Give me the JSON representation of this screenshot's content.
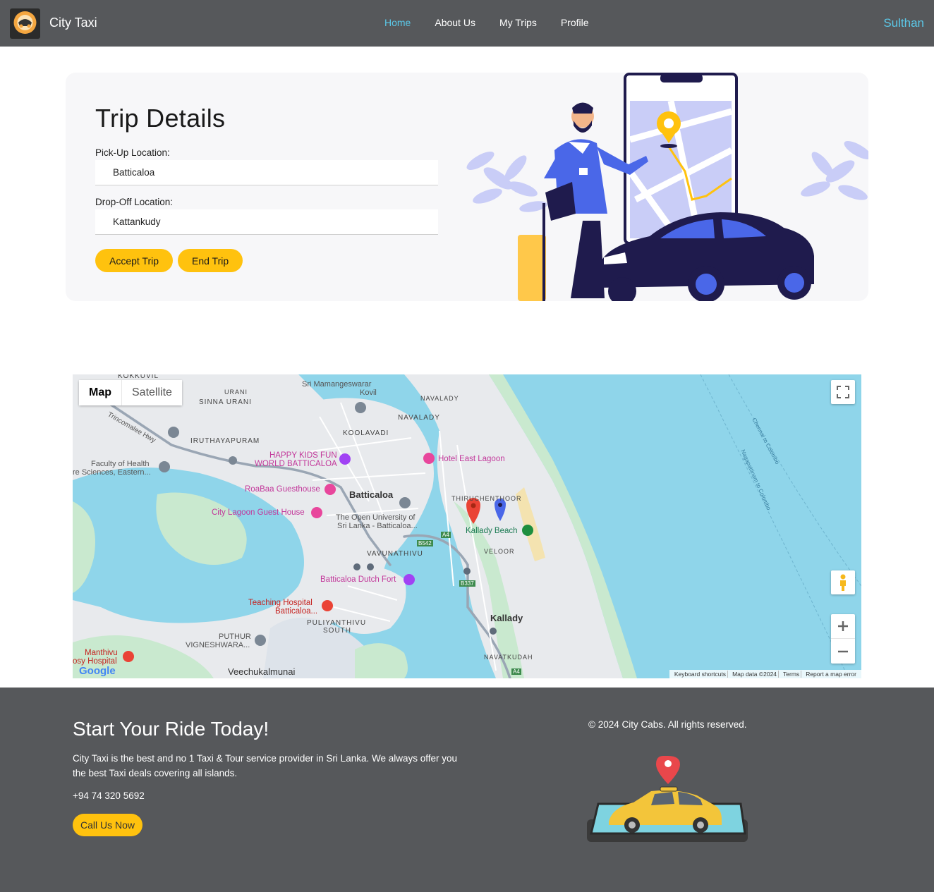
{
  "navbar": {
    "brand": "City Taxi",
    "links": [
      "Home",
      "About Us",
      "My Trips",
      "Profile"
    ],
    "user": "Sulthan"
  },
  "trip": {
    "title": "Trip Details",
    "pickup_label": "Pick-Up Location:",
    "pickup_value": "Batticaloa",
    "dropoff_label": "Drop-Off Location:",
    "dropoff_value": "Kattankudy",
    "accept_label": "Accept Trip",
    "end_label": "End Trip"
  },
  "map": {
    "type_map": "Map",
    "type_satellite": "Satellite",
    "labels": {
      "kokkuvil": "KOKKUVIL",
      "urani": "URANI",
      "sinna_urani": "SINNA URANI",
      "mamangeswarar": "Sri Mamangeswarar",
      "kovil": "Kovil",
      "navalady_top": "NAVALADY",
      "navalady": "NAVALADY",
      "trincomalee_hwy": "Trincomalee Hwy",
      "koolavadi": "KOOLAVADI",
      "iruthayapuram": "IRUTHAYAPURAM",
      "happy_kids": "HAPPY KIDS FUN",
      "world_batticaloa": "WORLD BATTICALOA",
      "hotel_east_lagoon": "Hotel East Lagoon",
      "faculty1": "Faculty of Health",
      "faculty2": "re Sciences, Eastern...",
      "roabaa": "RoaBaa Guesthouse",
      "batticaloa": "Batticaloa",
      "thiruchenthoor": "THIRUCHENTHOOR",
      "city_lagoon": "City Lagoon Guest House",
      "open_university1": "The Open University of",
      "open_university2": "Sri Lanka - Batticaloa...",
      "kallady_beach": "Kallady Beach",
      "b542": "B542",
      "a4_top": "A4",
      "vavunathivu": "VAVUNATHIVU",
      "veloor": "VELOOR",
      "dutch_fort": "Batticaloa Dutch Fort",
      "b337": "B337",
      "teaching_hospital1": "Teaching Hospital",
      "teaching_hospital2": "Batticaloa...",
      "kallady": "Kallady",
      "puliyanthivu1": "PULIYANTHIVU",
      "puliyanthivu2": "SOUTH",
      "puthur1": "PUTHUR",
      "puthur2": "VIGNESHWARA...",
      "manthivu1": "Manthivu",
      "manthivu2": "osy Hospital",
      "navatkudah": "NAVATKUDAH",
      "veechukalmunai": "Veechukalmunai",
      "a4_bottom": "A4",
      "chennai_colombo": "Chennai to Colombo",
      "nagapattinam_colombo": "Nagapattinam to Colombo"
    },
    "footer": [
      "Keyboard shortcuts",
      "Map data ©2024",
      "Terms",
      "Report a map error"
    ],
    "google": "Google"
  },
  "footer": {
    "title": "Start Your Ride Today!",
    "text": "City Taxi is the best and no 1 Taxi & Tour service provider in Sri Lanka. We always offer you the best Taxi deals covering all islands.",
    "phone": "+94 74 320 5692",
    "call_label": "Call Us Now",
    "copyright": "© 2024 City Cabs. All rights reserved."
  },
  "colors": {
    "navbar": "#56585b",
    "accent": "#5bc8e8",
    "button": "#ffc20e",
    "card": "#f7f7f9",
    "water": "#8fd5ea"
  }
}
